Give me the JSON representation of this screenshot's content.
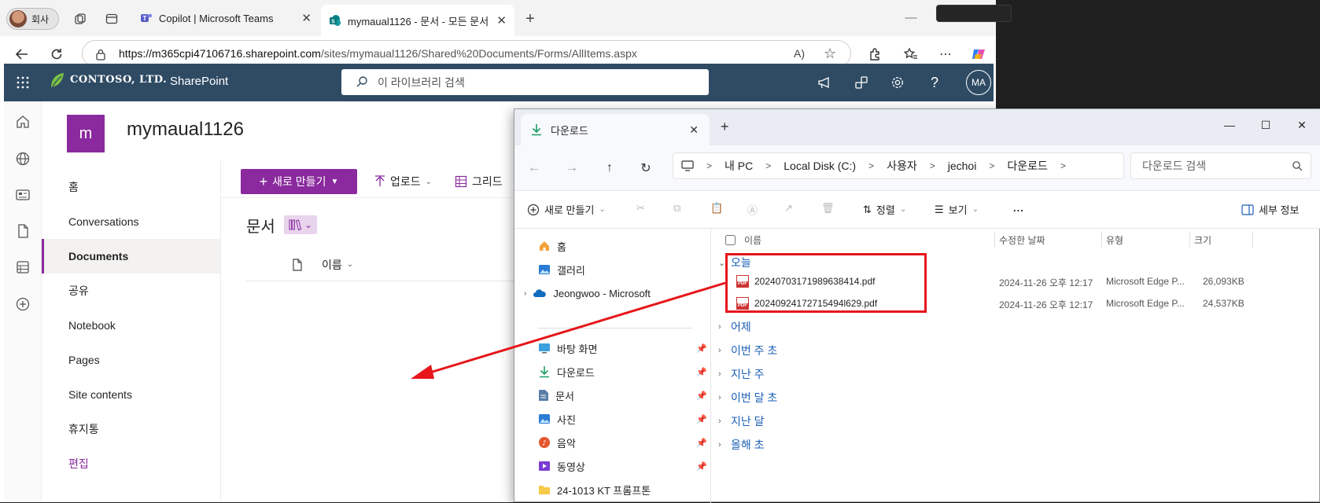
{
  "browser": {
    "profile_label": "회사",
    "tabs": [
      {
        "label": "Copilot | Microsoft Teams"
      },
      {
        "label": "mymaual1126 - 문서 - 모든 문서"
      }
    ],
    "url_host": "https://m365cpi47106716.sharepoint.com",
    "url_path": "/sites/mymaual1126/Shared%20Documents/Forms/AllItems.aspx"
  },
  "sharepoint": {
    "brand": "CONTOSO, LTD.",
    "app_name": "SharePoint",
    "search_placeholder": "이 라이브러리 검색",
    "avatar_initials": "MA",
    "site_logo_letter": "m",
    "site_title": "mymaual1126",
    "nav": [
      {
        "label": "홈"
      },
      {
        "label": "Conversations"
      },
      {
        "label": "Documents"
      },
      {
        "label": "공유"
      },
      {
        "label": "Notebook"
      },
      {
        "label": "Pages"
      },
      {
        "label": "Site contents"
      },
      {
        "label": "휴지통"
      },
      {
        "label": "편집"
      }
    ],
    "new_button": "새로 만들기",
    "upload_button": "업로드",
    "grid_button": "그리드",
    "library_title": "문서",
    "name_column": "이름"
  },
  "explorer": {
    "tab_title": "다운로드",
    "breadcrumbs": [
      "내 PC",
      "Local Disk (C:)",
      "사용자",
      "jechoi",
      "다운로드"
    ],
    "search_placeholder": "다운로드 검색",
    "commands": {
      "new": "새로 만들기",
      "sort": "정렬",
      "view": "보기",
      "more": "...",
      "details": "세부 정보"
    },
    "sidebar": [
      {
        "label": "홈",
        "icon": "home-icon"
      },
      {
        "label": "갤러리",
        "icon": "gallery-icon"
      },
      {
        "label": "Jeongwoo - Microsoft",
        "icon": "onedrive-icon"
      },
      {
        "label": "바탕 화면",
        "icon": "desktop-icon"
      },
      {
        "label": "다운로드",
        "icon": "download-icon"
      },
      {
        "label": "문서",
        "icon": "documents-icon"
      },
      {
        "label": "사진",
        "icon": "pictures-icon"
      },
      {
        "label": "음악",
        "icon": "music-icon"
      },
      {
        "label": "동영상",
        "icon": "videos-icon"
      },
      {
        "label": "24-1013 KT 프롬프톤",
        "icon": "folder-icon"
      }
    ],
    "columns": {
      "name": "이름",
      "modified": "수정한 날짜",
      "type": "유형",
      "size": "크기"
    },
    "groups": [
      "오늘",
      "어제",
      "이번 주 초",
      "지난 주",
      "이번 달 초",
      "지난 달",
      "올해 초"
    ],
    "files": [
      {
        "name": "20240703171989638414.pdf",
        "modified": "2024-11-26 오후 12:17",
        "type": "Microsoft Edge P...",
        "size": "26,093KB"
      },
      {
        "name": "20240924172715494l629.pdf",
        "modified": "2024-11-26 오후 12:17",
        "type": "Microsoft Edge P...",
        "size": "24,537KB"
      }
    ]
  },
  "colors": {
    "sp_header": "#2f4b64",
    "sp_accent": "#8a2a9e",
    "annotation": "#e6161b"
  }
}
